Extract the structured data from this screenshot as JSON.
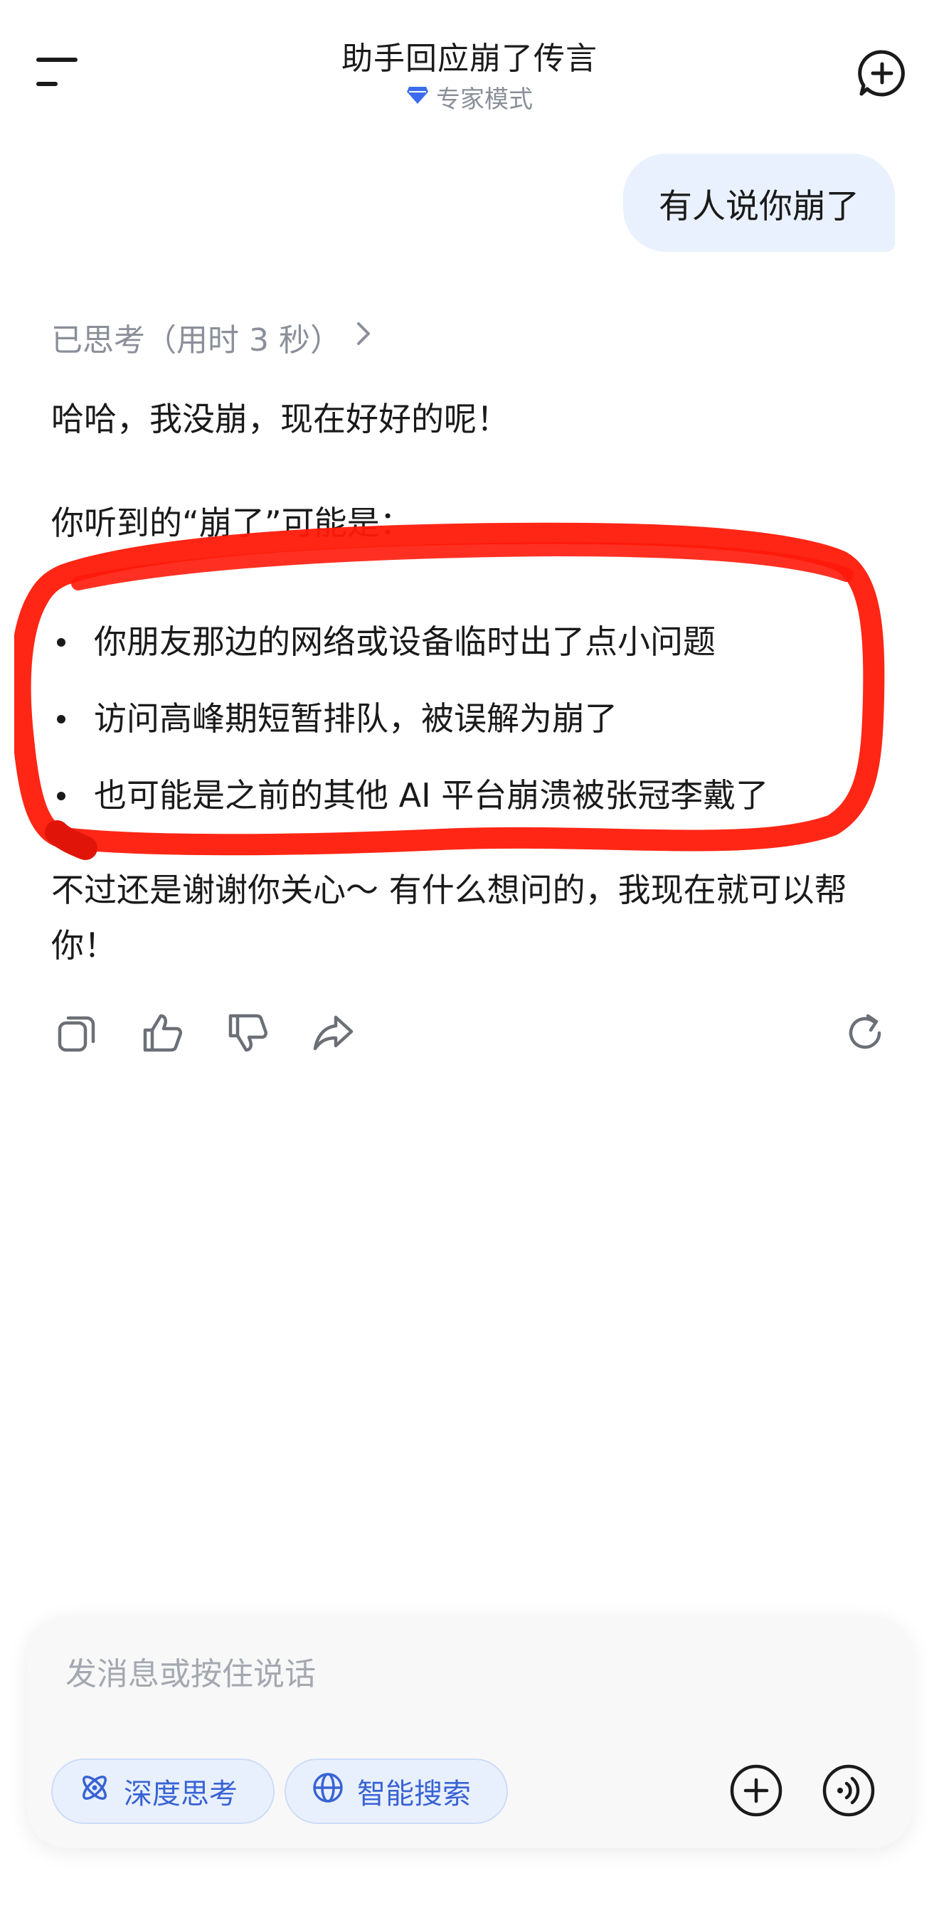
{
  "header": {
    "title": "助手回应崩了传言",
    "mode_label": "专家模式"
  },
  "conversation": {
    "user_message": "有人说你崩了",
    "thinking_label": "已思考（用时 3 秒）",
    "answer": {
      "paragraph1": "哈哈，我没崩，现在好好的呢！",
      "paragraph2": "你听到的“崩了”可能是：",
      "bullets": [
        "你朋友那边的网络或设备临时出了点小问题",
        "访问高峰期短暂排队，被误解为崩了",
        "也可能是之前的其他 AI 平台崩溃被张冠李戴了"
      ],
      "paragraph3": "不过还是谢谢你关心～ 有什么想问的，我现在就可以帮你！"
    }
  },
  "composer": {
    "placeholder": "发消息或按住说话",
    "chip_deep_think": "深度思考",
    "chip_smart_search": "智能搜索"
  },
  "icons": {
    "menu": "menu-icon",
    "new_chat": "new-chat-icon",
    "mode": "diamond-icon",
    "thinking_chevron": "chevron-right-icon",
    "copy": "copy-icon",
    "thumbs_up": "thumbs-up-icon",
    "thumbs_down": "thumbs-down-icon",
    "share": "share-icon",
    "regenerate": "refresh-icon",
    "deep_think": "atom-icon",
    "smart_search": "globe-icon",
    "add": "plus-circle-icon",
    "voice": "voice-icon"
  },
  "colors": {
    "accent": "#3863d4",
    "user_bubble": "#eaf1fe",
    "annotation": "#ff1a0a"
  }
}
